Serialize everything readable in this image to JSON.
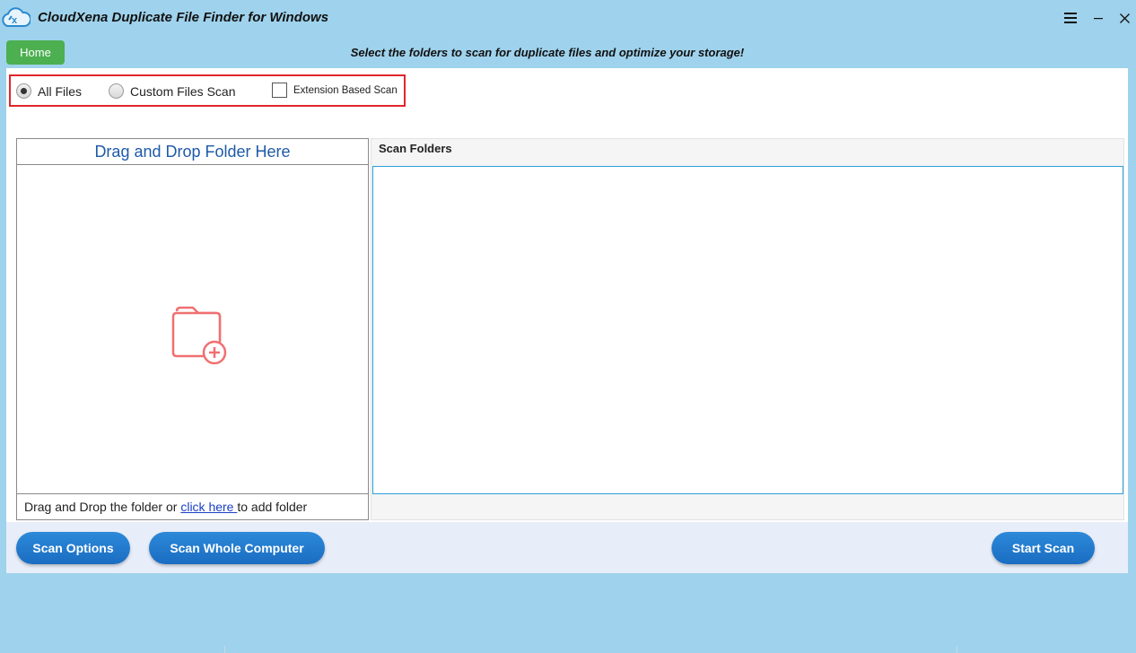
{
  "window": {
    "title": "CloudXena Duplicate File Finder for Windows",
    "logo_icon": "cloud-duplicate-logo-icon",
    "controls": {
      "menu": "≡",
      "minimize": "−",
      "close": "✕"
    }
  },
  "header": {
    "home_label": "Home",
    "subtitle": "Select the folders to scan for duplicate files and optimize your storage!"
  },
  "scan_type": {
    "all_files_label": "All Files",
    "all_files_selected": true,
    "custom_files_label": "Custom Files Scan",
    "custom_files_selected": false,
    "extension_label": "Extension Based Scan",
    "extension_checked": false,
    "highlight_color": "#e0252c"
  },
  "drop_zone": {
    "title": "Drag and Drop Folder Here",
    "icon": "folder-add-icon",
    "footer_prefix": "Drag and Drop the folder or ",
    "footer_link": " click here ",
    "footer_suffix": " to add folder"
  },
  "scan_folders": {
    "header": "Scan Folders",
    "items": []
  },
  "actions": {
    "scan_options": "Scan Options",
    "scan_whole_computer": "Scan Whole Computer",
    "start_scan": "Start Scan"
  },
  "colors": {
    "background": "#9fd2ec",
    "home_button": "#4caf50",
    "primary_button": "#1a6dc2",
    "link": "#1a3fc4",
    "drop_title": "#1e5aa8",
    "folder_icon": "#f07070"
  }
}
